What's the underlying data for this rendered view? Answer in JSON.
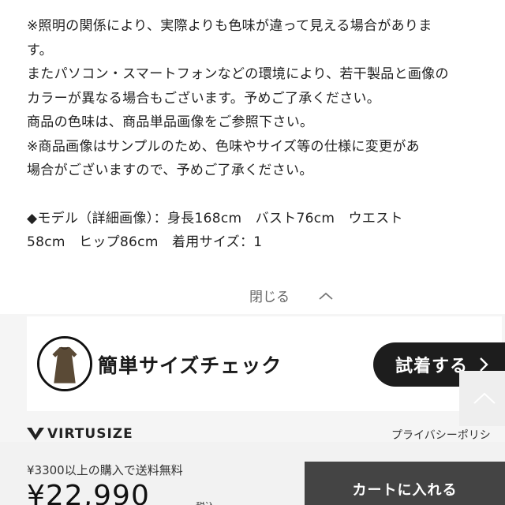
{
  "notes": {
    "lines": [
      "※照明の関係により、実際よりも色味が違って見える場合がありま",
      "す。",
      "またパソコン・スマートフォンなどの環境により、若干製品と画像の",
      "カラーが異なる場合もございます。予めご了承ください。",
      "商品の色味は、商品単品画像をご参照下さい。",
      "※商品画像はサンプルのため、色味やサイズ等の仕様に変更があ",
      "場合がございますので、予めご了承ください。"
    ],
    "model_lines": [
      "◆モデル（詳細画像）：身長168cm　バスト76cm　ウエスト",
      "58cm　ヒップ86cm　着用サイズ：1"
    ]
  },
  "toggle": {
    "label": "閉じる",
    "icon": "chevron-up-icon"
  },
  "size_check": {
    "title": "簡単サイズチェック",
    "button_label": "試着する",
    "button_icon": "chevron-right-icon",
    "avatar_icon": "dress-icon"
  },
  "scroll_top": {
    "icon": "chevron-up-icon"
  },
  "virtusize": {
    "logo_text": "VIRTUSIZE",
    "privacy_label": "プライバシーポリシ"
  },
  "purchase_bar": {
    "shipping_note": "¥3300以上の購入で送料無料",
    "price": "¥22,990",
    "tax_label": "税込",
    "cart_button_label": "カートに入れる"
  },
  "colors": {
    "accent_dark": "#1d1d1d",
    "cart_button": "#444444",
    "bar_bg": "#f2f2f2"
  }
}
